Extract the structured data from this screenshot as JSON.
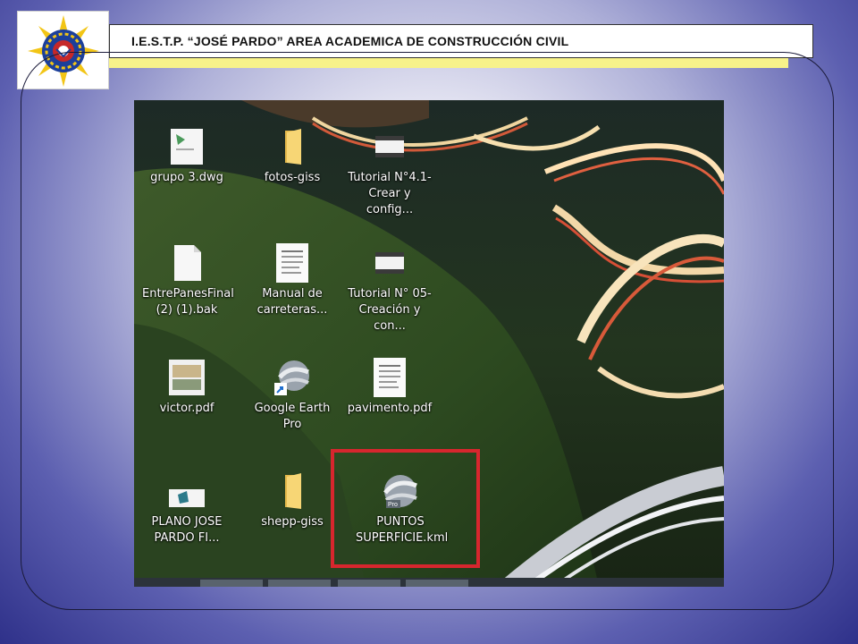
{
  "header": {
    "title": "I.E.S.T.P. “JOSÉ PARDO” AREA ACADEMICA DE CONSTRUCCIÓN CIVIL"
  },
  "colors": {
    "highlight": "#d7262e",
    "header_stripe": "#f7f28a",
    "background_dark": "#2f318a"
  },
  "desktop": {
    "icons": [
      {
        "label": "grupo 3.dwg",
        "icon": "dwg-file-icon"
      },
      {
        "label": "fotos-giss",
        "icon": "folder-icon"
      },
      {
        "label": "Tutorial N°4.1-\nCrear y config...",
        "icon": "video-file-icon"
      },
      {
        "label": "EntrePanesFinal\n(2) (1).bak",
        "icon": "blank-file-icon"
      },
      {
        "label": "Manual de\ncarreteras...",
        "icon": "pdf-document-icon"
      },
      {
        "label": "Tutorial N° 05-\nCreación y con...",
        "icon": "video-file-icon"
      },
      {
        "label": "victor.pdf",
        "icon": "pdf-thumbnail-icon"
      },
      {
        "label": "Google Earth Pro",
        "icon": "google-earth-shortcut-icon"
      },
      {
        "label": "pavimento.pdf",
        "icon": "pdf-document-icon"
      },
      {
        "label": "PLANO JOSE\nPARDO FI...",
        "icon": "drawing-file-icon"
      },
      {
        "label": "shepp-giss",
        "icon": "folder-icon"
      },
      {
        "label": "PUNTOS\nSUPERFICIE.kml",
        "icon": "google-earth-kml-icon"
      }
    ]
  }
}
